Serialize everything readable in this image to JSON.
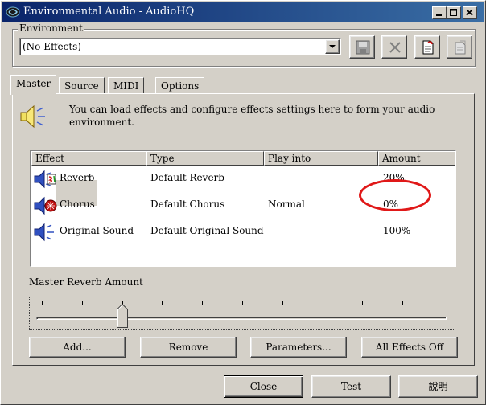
{
  "window": {
    "title": "Environmental Audio - AudioHQ"
  },
  "environment": {
    "group_label": "Environment",
    "selected": "(No Effects)"
  },
  "tabs": [
    {
      "label": "Master"
    },
    {
      "label": "Source"
    },
    {
      "label": "MIDI"
    },
    {
      "label": "Options"
    }
  ],
  "master": {
    "description": "You can load effects and configure effects settings here to form your audio environment.",
    "columns": [
      "Effect",
      "Type",
      "Play into",
      "Amount"
    ],
    "rows": [
      {
        "effect": "Reverb",
        "type": "Default Reverb",
        "play_into": "",
        "amount": "20%"
      },
      {
        "effect": "Chorus",
        "type": "Default Chorus",
        "play_into": "Normal",
        "amount": "0%"
      },
      {
        "effect": "Original Sound",
        "type": "Default Original Sound",
        "play_into": "",
        "amount": "100%"
      }
    ],
    "slider_label": "Master Reverb Amount",
    "slider_value": 0.2,
    "buttons": {
      "add": "Add...",
      "remove": "Remove",
      "parameters": "Parameters...",
      "all_off": "All Effects Off"
    }
  },
  "footer": {
    "close": "Close",
    "test": "Test",
    "help": "說明"
  },
  "colors": {
    "title_bar_start": "#0a246a",
    "title_bar_end": "#3a6ea5",
    "annotation_circle": "#e01818"
  }
}
